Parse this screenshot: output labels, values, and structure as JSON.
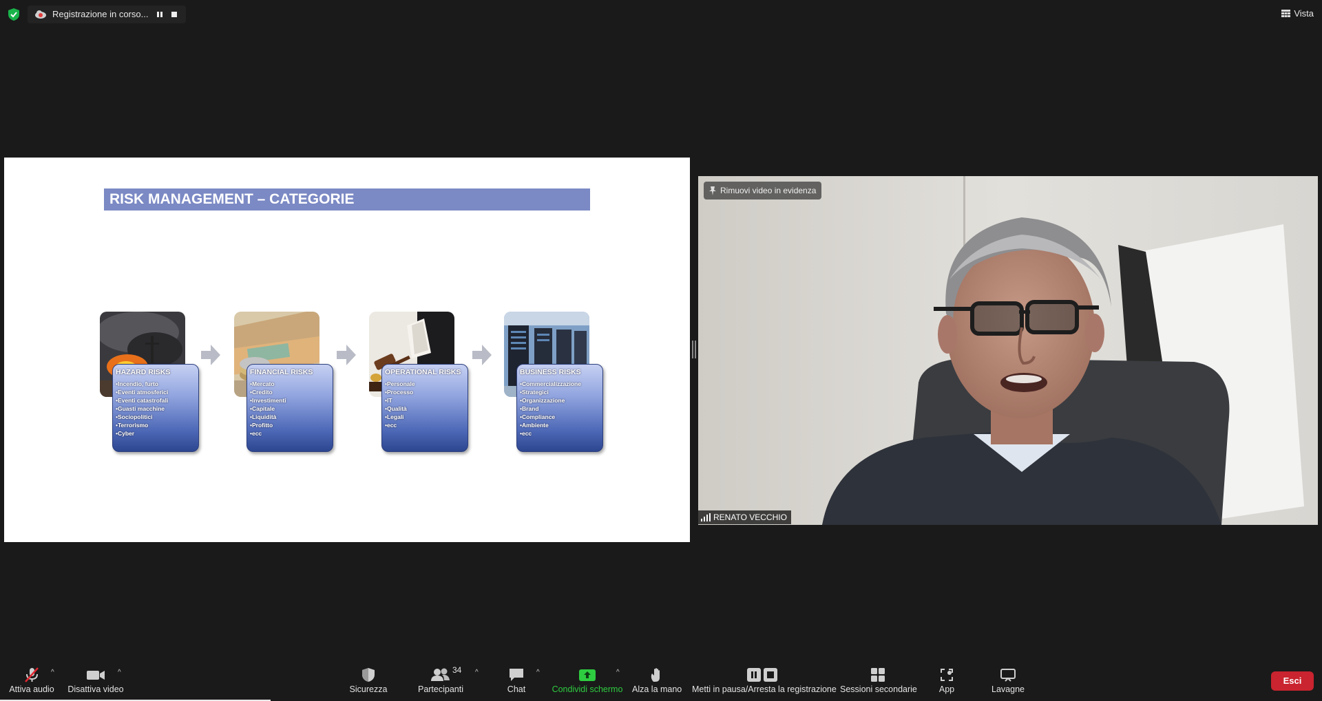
{
  "topbar": {
    "recording_label": "Registrazione in corso...",
    "view_label": "Vista"
  },
  "slide": {
    "title": "RISK MANAGEMENT – CATEGORIE",
    "categories": [
      {
        "title": "HAZARD RISKS",
        "items": [
          "•Incendio, furto",
          "•Eventi  atmosferici",
          "•Eventi catastrofali",
          "•Guasti macchine",
          "•Sociopolitici",
          "•Terrorismo",
          "•Cyber"
        ]
      },
      {
        "title": "FINANCIAL RISKS",
        "items": [
          "•Mercato",
          "•Credito",
          "•Investimenti",
          "•Capitale",
          "•Liquidità",
          "•Profitto",
          "•ecc"
        ]
      },
      {
        "title": "OPERATIONAL RISKS",
        "items": [
          "•Personale",
          "•Processo",
          "•IT",
          "•Qualità",
          "•Legali",
          "•ecc"
        ]
      },
      {
        "title": "BUSINESS RISKS",
        "items": [
          "•Commercializzazione",
          "•Strategici",
          "•Organizzazione",
          "•Brand",
          "•Compliance",
          "•Ambiente",
          "•ecc"
        ]
      }
    ]
  },
  "video": {
    "spotlight_label": "Rimuovi video in evidenza",
    "participant_name": "RENATO VECCHIO"
  },
  "toolbar": {
    "audio_label": "Attiva audio",
    "video_label": "Disattiva video",
    "security_label": "Sicurezza",
    "participants_label": "Partecipanti",
    "participants_count": "34",
    "chat_label": "Chat",
    "share_label": "Condividi schermo",
    "raise_hand_label": "Alza la mano",
    "recording_label": "Metti in pausa/Arresta la registrazione",
    "breakout_label": "Sessioni secondarie",
    "apps_label": "App",
    "whiteboard_label": "Lavagne",
    "leave_label": "Esci"
  },
  "colors": {
    "share_green": "#2ecc40",
    "leave_red": "#c9242f",
    "slide_title_bg": "#7b89c4"
  }
}
